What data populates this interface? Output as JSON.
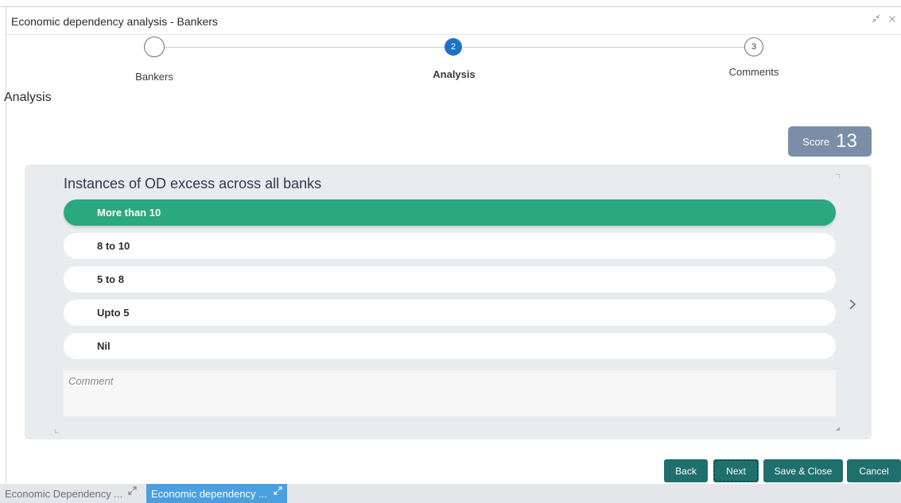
{
  "window": {
    "title": "Economic dependency analysis - Bankers",
    "minimize_icon": "collapse-arrows-icon",
    "close_icon": "close-icon"
  },
  "stepper": {
    "steps": [
      {
        "number": "",
        "label": "Bankers",
        "state": "completed"
      },
      {
        "number": "2",
        "label": "Analysis",
        "state": "active"
      },
      {
        "number": "3",
        "label": "Comments",
        "state": "pending"
      }
    ]
  },
  "section": {
    "title": "Analysis"
  },
  "score": {
    "label": "Score",
    "value": "13"
  },
  "question": {
    "text": "Instances of OD excess across all banks",
    "options": [
      {
        "label": "More than 10",
        "selected": true
      },
      {
        "label": "8 to 10",
        "selected": false
      },
      {
        "label": "5 to 8",
        "selected": false
      },
      {
        "label": "Upto 5",
        "selected": false
      },
      {
        "label": "Nil",
        "selected": false
      }
    ],
    "comment_placeholder": "Comment",
    "next_icon": "chevron-right-icon"
  },
  "buttons": {
    "back": "Back",
    "next": "Next",
    "save_close": "Save & Close",
    "cancel": "Cancel"
  },
  "taskbar": {
    "tabs": [
      {
        "label": "Economic Dependency ...",
        "active": false
      },
      {
        "label": "Economic dependency ...",
        "active": true
      }
    ]
  },
  "colors": {
    "selected_option": "#2aa87e",
    "active_step": "#1a72c9",
    "score_badge": "#7b8ea8",
    "button": "#1f6f6c",
    "active_tab": "#4a9fe0"
  }
}
